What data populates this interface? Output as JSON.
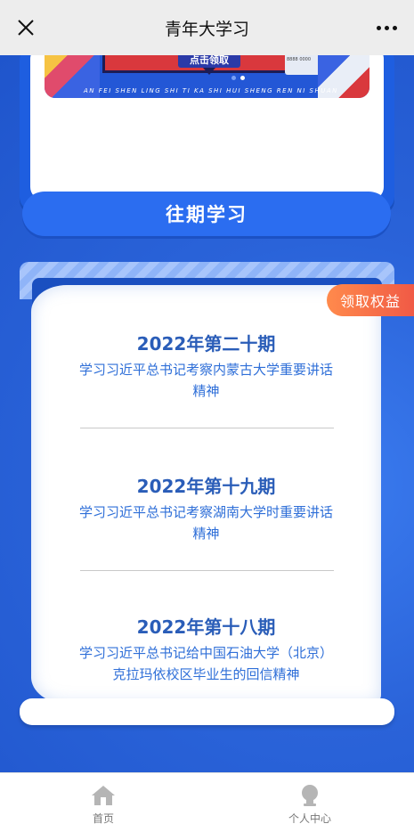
{
  "topbar": {
    "title": "青年大学习",
    "close_icon": "close-icon",
    "more_icon": "more-icon"
  },
  "banner": {
    "button_label": "点击领取",
    "pinyin_text": "AN FEI SHEN LING SHI TI KA   SHI HUI SHENG REN NI SHUAN",
    "card_text": "6230 9680 8888 0000"
  },
  "section": {
    "title": "往期学习"
  },
  "benefit_button": "领取权益",
  "entries": [
    {
      "period": "2022年第二十期",
      "subtitle": "学习习近平总书记考察内蒙古大学重要讲话精神"
    },
    {
      "period": "2022年第十九期",
      "subtitle": "学习习近平总书记考察湖南大学时重要讲话精神"
    },
    {
      "period": "2022年第十八期",
      "subtitle": "学习习近平总书记给中国石油大学（北京）克拉玛依校区毕业生的回信精神"
    }
  ],
  "tabbar": {
    "home": {
      "label": "首页",
      "icon": "home-icon"
    },
    "profile": {
      "label": "个人中心",
      "icon": "user-icon"
    }
  },
  "colors": {
    "background": "#2a63d9",
    "accent_orange": "#f05a46",
    "period_text": "#2a5db8"
  }
}
